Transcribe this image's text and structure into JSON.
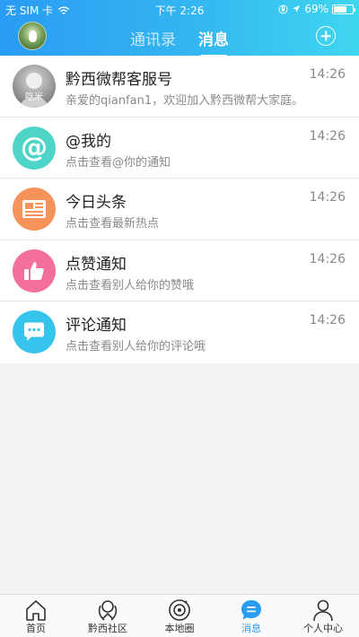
{
  "status_bar": {
    "carrier": "无 SIM 卡",
    "time": "下午 2:26",
    "battery": "69%",
    "battery_level": 0.69
  },
  "nav": {
    "tabs": [
      {
        "label": "通讯录",
        "active": false
      },
      {
        "label": "消息",
        "active": true
      }
    ]
  },
  "messages": [
    {
      "title": "黔西微帮客服号",
      "subtitle": "亲爱的qianfan1，欢迎加入黔西微帮大家庭。",
      "time": "14:26",
      "icon": "user-avatar-photo",
      "avatar_text": "吃米",
      "color": "#8a8a8a"
    },
    {
      "title": "@我的",
      "subtitle": "点击查看@你的通知",
      "time": "14:26",
      "icon": "at-icon",
      "color": "#4fd5c8"
    },
    {
      "title": "今日头条",
      "subtitle": "点击查看最新热点",
      "time": "14:26",
      "icon": "newspaper-icon",
      "color": "#f7925a"
    },
    {
      "title": "点赞通知",
      "subtitle": "点击查看别人给你的赞哦",
      "time": "14:26",
      "icon": "thumbs-up-icon",
      "color": "#f36f9e"
    },
    {
      "title": "评论通知",
      "subtitle": "点击查看别人给你的评论哦",
      "time": "14:26",
      "icon": "comment-icon",
      "color": "#37c4ec"
    }
  ],
  "tabbar": [
    {
      "label": "首页",
      "icon": "home-icon",
      "active": false
    },
    {
      "label": "黔西社区",
      "icon": "community-icon",
      "active": false
    },
    {
      "label": "本地圈",
      "icon": "local-circle-icon",
      "active": false
    },
    {
      "label": "消息",
      "icon": "message-icon",
      "active": true
    },
    {
      "label": "个人中心",
      "icon": "person-icon",
      "active": false
    }
  ],
  "colors": {
    "accent": "#2a9cf4",
    "header_start": "#2a9cf4",
    "header_end": "#3fd6f0"
  }
}
